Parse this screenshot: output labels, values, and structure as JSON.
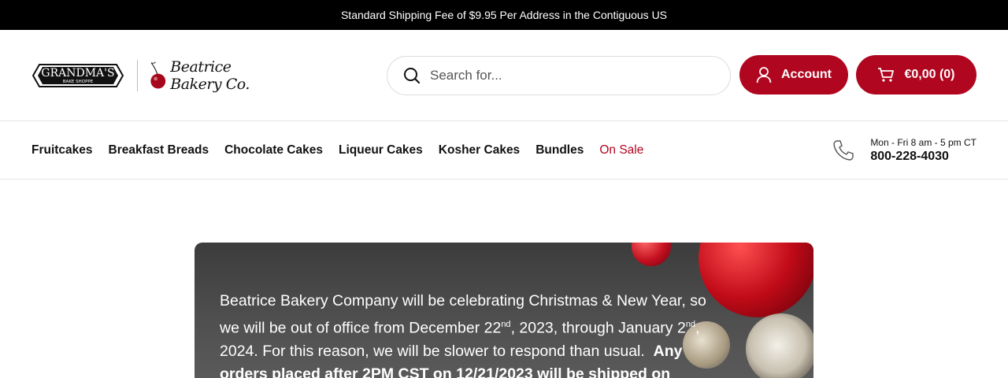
{
  "announcement": "Standard Shipping Fee of $9.95 Per Address in the Contiguous US",
  "brand": {
    "grandmas_line1": "GRANDMA'S",
    "grandmas_line2": "BAKE SHOPPE",
    "beatrice": "Beatrice Bakery Co."
  },
  "search": {
    "placeholder": "Search for..."
  },
  "account": {
    "label": "Account"
  },
  "cart": {
    "label": "€0,00 (0)"
  },
  "nav": [
    "Fruitcakes",
    "Breakfast Breads",
    "Chocolate Cakes",
    "Liqueur Cakes",
    "Kosher Cakes",
    "Bundles",
    "On Sale"
  ],
  "contact": {
    "hours": "Mon - Fri 8 am - 5 pm CT",
    "phone": "800-228-4030"
  },
  "banner": {
    "line1": "Beatrice Bakery Company will be celebrating Christmas & New Year, so",
    "line2a": "we will be out of office from December 22",
    "line2sup1": "nd",
    "line2b": ", 2023, through January 2",
    "line2sup2": "nd",
    "line2c": ",",
    "line3a": "2024. For this reason, we will be slower to respond than usual.",
    "line3b": "Any",
    "line4": "orders placed after 2PM CST on 12/21/2023 will be shipped on"
  },
  "colors": {
    "accent": "#b0061f",
    "topbar": "#000000"
  },
  "icons": [
    "search-icon",
    "user-icon",
    "cart-icon",
    "phone-icon",
    "cherry-icon"
  ]
}
